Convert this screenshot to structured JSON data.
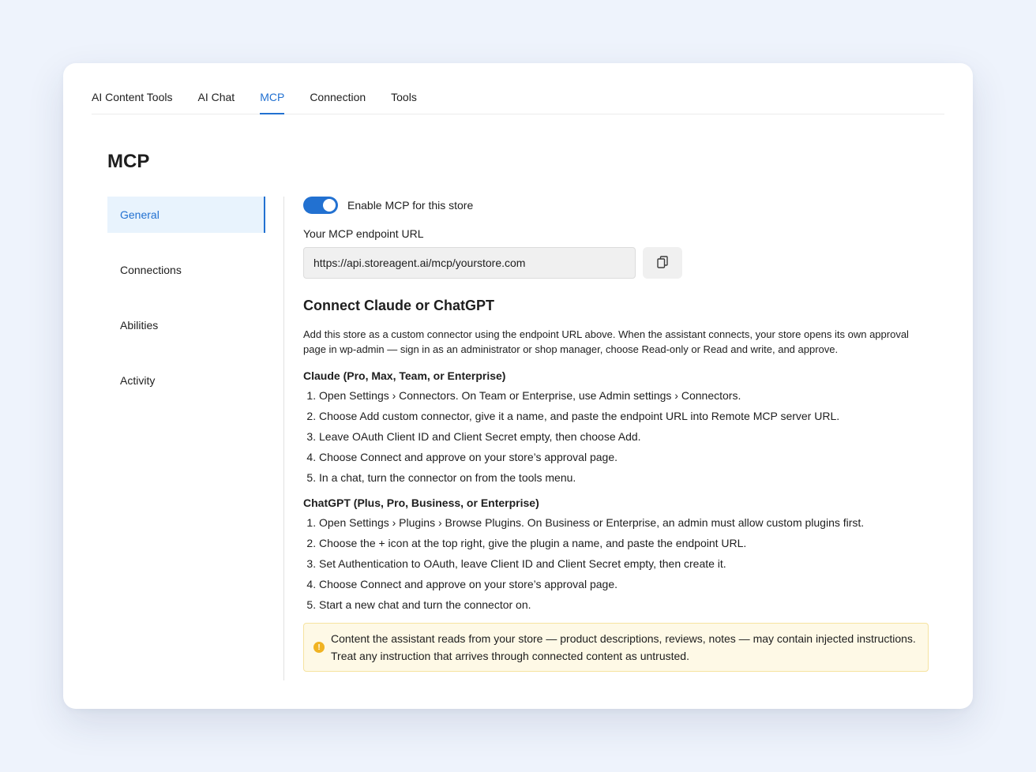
{
  "tabs": [
    {
      "label": "AI Content Tools"
    },
    {
      "label": "AI Chat"
    },
    {
      "label": "MCP"
    },
    {
      "label": "Connection"
    },
    {
      "label": "Tools"
    }
  ],
  "active_tab": "MCP",
  "page_title": "MCP",
  "sidebar": {
    "items": [
      {
        "label": "General"
      },
      {
        "label": "Connections"
      },
      {
        "label": "Abilities"
      },
      {
        "label": "Activity"
      }
    ],
    "active": "General"
  },
  "general": {
    "toggle_label": "Enable MCP for this store",
    "toggle_on": true,
    "endpoint_label": "Your MCP endpoint URL",
    "endpoint_value": "https://api.storeagent.ai/mcp/yourstore.com",
    "copy_icon": "copy-icon",
    "section_title": "Connect Claude or ChatGPT",
    "intro": "Add this store as a custom connector using the endpoint URL above. When the assistant connects, your store opens its own approval page in wp-admin — sign in as an administrator or shop manager, choose Read-only or Read and write, and approve.",
    "claude": {
      "title": "Claude (Pro, Max, Team, or Enterprise)",
      "steps": [
        "Open Settings › Connectors. On Team or Enterprise, use Admin settings › Connectors.",
        "Choose Add custom connector, give it a name, and paste the endpoint URL into Remote MCP server URL.",
        "Leave OAuth Client ID and Client Secret empty, then choose Add.",
        "Choose Connect and approve on your store’s approval page.",
        "In a chat, turn the connector on from the tools menu."
      ]
    },
    "chatgpt": {
      "title": "ChatGPT (Plus, Pro, Business, or Enterprise)",
      "steps": [
        "Open Settings › Plugins › Browse Plugins. On Business or Enterprise, an admin must allow custom plugins first.",
        "Choose the + icon at the top right, give the plugin a name, and paste the endpoint URL.",
        "Set Authentication to OAuth, leave Client ID and Client Secret empty, then create it.",
        "Choose Connect and approve on your store’s approval page.",
        "Start a new chat and turn the connector on."
      ]
    },
    "notice": {
      "icon": "warning-icon",
      "icon_glyph": "!",
      "text": "Content the assistant reads from your store — product descriptions, reviews, notes — may contain injected instructions. Treat any instruction that arrives through connected content as untrusted."
    }
  },
  "colors": {
    "accent": "#2271d1",
    "notice_bg": "#fef9e6",
    "notice_border": "#f6e3a0",
    "warning": "#f0b323",
    "page_bg": "#eef3fc"
  }
}
